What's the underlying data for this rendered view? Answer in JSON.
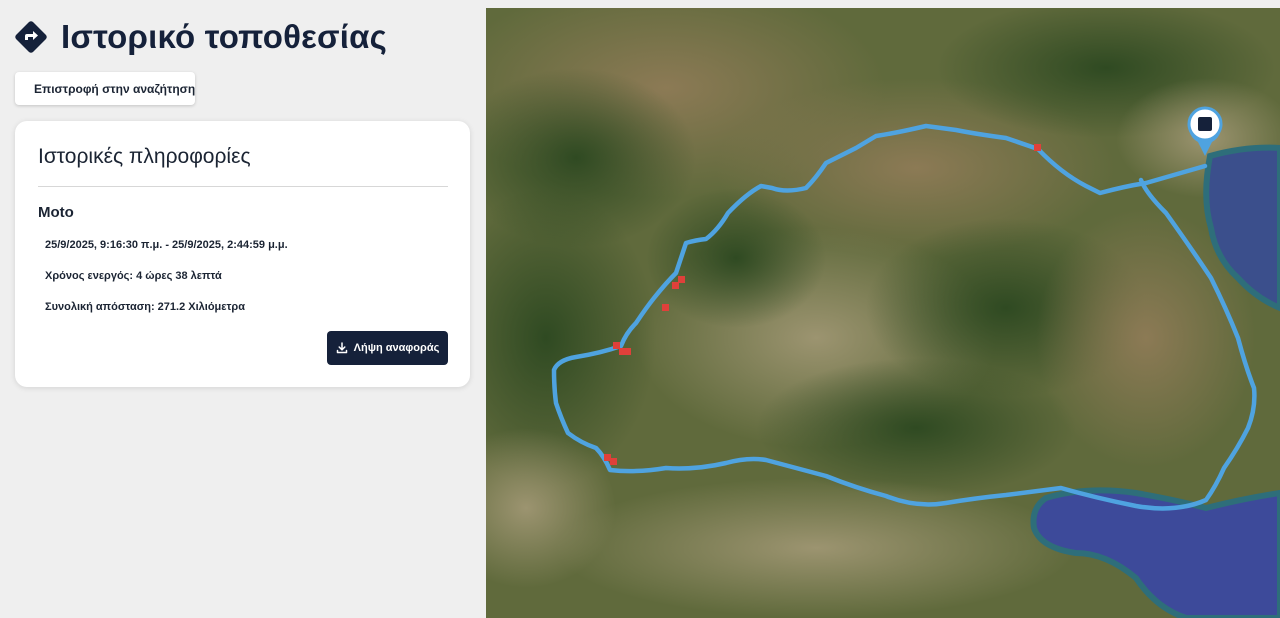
{
  "header": {
    "title": "Ιστορικό τοποθεσίας",
    "icon": "directions-icon"
  },
  "back_button": {
    "label": "Επιστροφή στην αναζήτηση",
    "icon": "chevron-left-icon"
  },
  "info_card": {
    "title": "Ιστορικές πληροφορίες",
    "vehicle": "Moto",
    "date_range": "25/9/2025, 9:16:30 π.μ. - 25/9/2025, 2:44:59 μ.μ.",
    "active_time": "Χρόνος ενεργός: 4 ώρες 38 λεπτά",
    "total_distance": "Συνολική απόσταση: 271.2 Χιλιόμετρα",
    "download_button": "Λήψη αναφοράς",
    "download_icon": "download-icon"
  },
  "map": {
    "type": "satellite",
    "route_color": "#4fa3e0",
    "stop_marker_color": "#e0403a",
    "end_marker_icon": "stop-square-icon",
    "stop_marker_count": 9
  },
  "colors": {
    "primary": "#15213a",
    "background": "#efefef",
    "card": "#ffffff"
  }
}
